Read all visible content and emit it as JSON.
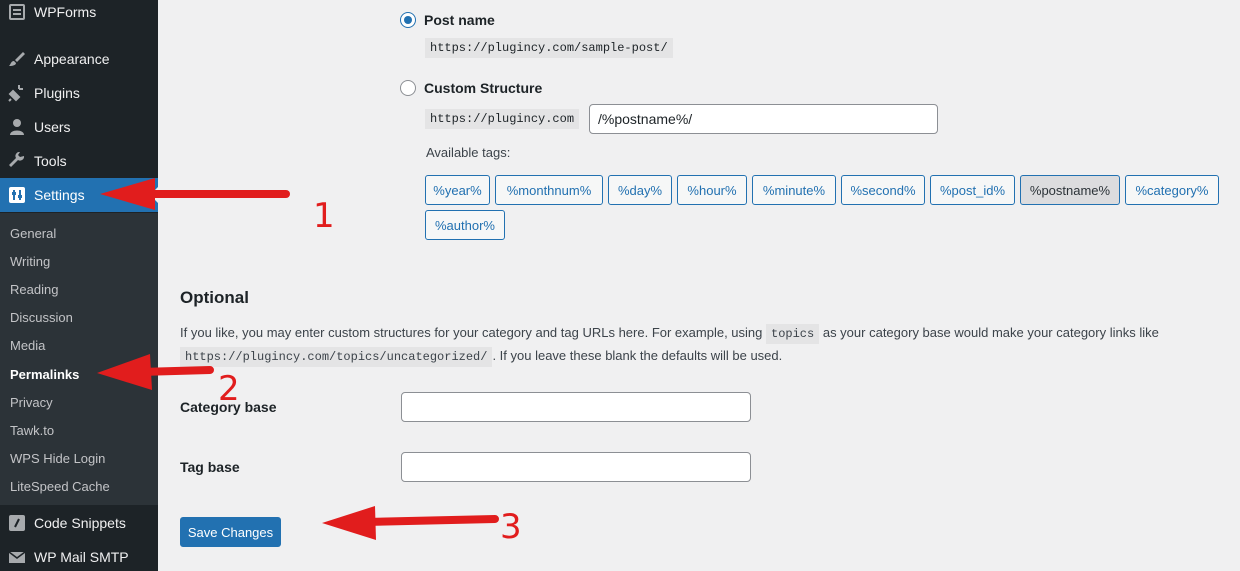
{
  "sidebar": {
    "top_items": [
      {
        "label": "WPForms",
        "icon": "wpforms-icon"
      },
      {
        "label": "Appearance",
        "icon": "paintbrush-icon"
      },
      {
        "label": "Plugins",
        "icon": "plugin-icon"
      },
      {
        "label": "Users",
        "icon": "user-icon"
      },
      {
        "label": "Tools",
        "icon": "wrench-icon"
      },
      {
        "label": "Settings",
        "icon": "settings-icon"
      }
    ],
    "submenu": [
      "General",
      "Writing",
      "Reading",
      "Discussion",
      "Media",
      "Permalinks",
      "Privacy",
      "Tawk.to",
      "WPS Hide Login",
      "LiteSpeed Cache"
    ],
    "bottom_items": [
      {
        "label": "Code Snippets",
        "icon": "code-snippets-icon"
      },
      {
        "label": "WP Mail SMTP",
        "icon": "mail-icon"
      }
    ]
  },
  "permalink": {
    "post_name_label": "Post name",
    "post_name_example": "https://plugincy.com/sample-post/",
    "custom_label": "Custom Structure",
    "custom_prefix": "https://plugincy.com",
    "custom_value": "/%postname%/",
    "available_tags_label": "Available tags:",
    "tags": [
      "%year%",
      "%monthnum%",
      "%day%",
      "%hour%",
      "%minute%",
      "%second%",
      "%post_id%",
      "%postname%",
      "%category%",
      "%author%"
    ]
  },
  "optional": {
    "heading": "Optional",
    "desc_1": "If you like, you may enter custom structures for your category and tag URLs here. For example, using",
    "desc_code_1": "topics",
    "desc_2": "as your category base would make your category links like",
    "desc_code_2": "https://plugincy.com/topics/uncategorized/",
    "desc_3": ". If you leave these blank the defaults will be used.",
    "category_base_label": "Category base",
    "category_base_value": "",
    "tag_base_label": "Tag base",
    "tag_base_value": ""
  },
  "save_label": "Save Changes",
  "annotations": [
    "1",
    "2",
    "3"
  ],
  "colors": {
    "accent": "#2271b1",
    "sidebar": "#1d2327",
    "annotation": "#e11d1d"
  }
}
